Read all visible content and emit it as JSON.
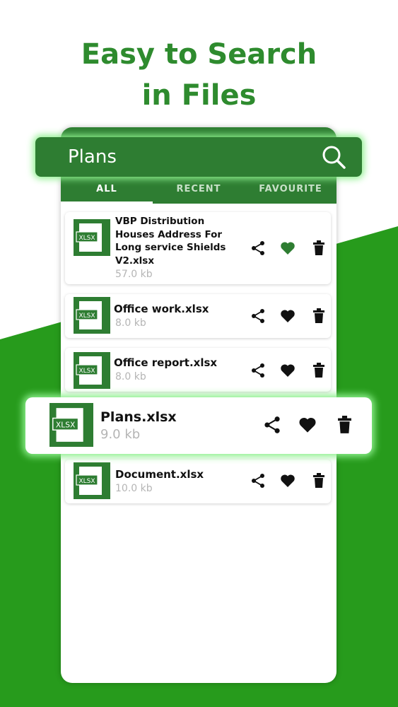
{
  "headline": {
    "line1": "Easy to Search",
    "line2": "in Files"
  },
  "search": {
    "query": "Plans"
  },
  "tabs": [
    {
      "label": "ALL",
      "active": true
    },
    {
      "label": "RECENT",
      "active": false
    },
    {
      "label": "FAVOURITE",
      "active": false
    }
  ],
  "files": [
    {
      "name_lines": [
        "VBP Distribution",
        "Houses Address For",
        "Long service Shields",
        "V2.xlsx"
      ],
      "size": "57.0 kb",
      "favourite": true,
      "icon": "xlsx-file-icon",
      "icon_label": "XLSX"
    },
    {
      "name": "Office work.xlsx",
      "size": "8.0 kb",
      "favourite": false,
      "icon": "xlsx-file-icon",
      "icon_label": "XLSX"
    },
    {
      "name": "Office report.xlsx",
      "size": "8.0 kb",
      "favourite": false,
      "icon": "xlsx-file-icon",
      "icon_label": "XLSX"
    },
    {
      "name": "Plans.xlsx",
      "size": "9.0 kb",
      "favourite": false,
      "highlighted": true,
      "icon": "xlsx-file-icon",
      "icon_label": "XLSX"
    },
    {
      "name": "Document.xlsx",
      "size": "10.0 kb",
      "favourite": false,
      "icon": "xlsx-file-icon",
      "icon_label": "XLSX"
    }
  ],
  "colors": {
    "brand_green": "#2e7d32",
    "headline_green": "#2e8b2e",
    "favourite_active": "#2e7d32",
    "glow": "#8ef08e"
  }
}
